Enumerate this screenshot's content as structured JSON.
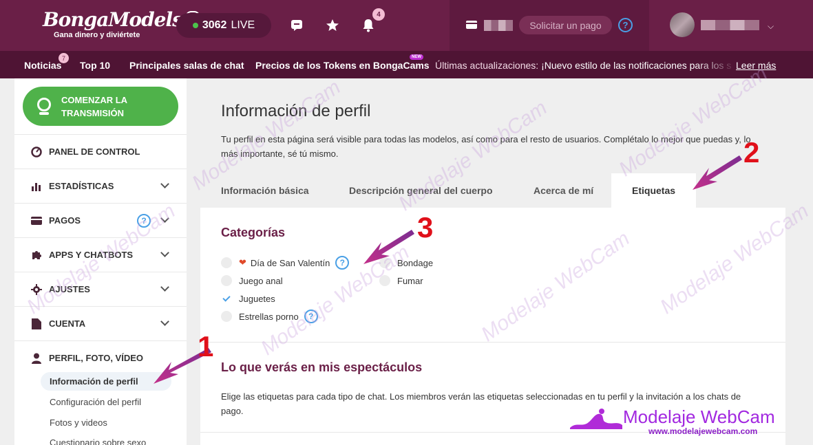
{
  "header": {
    "logo_text": "BongaModels",
    "logo_tagline": "Gana dinero y diviértete",
    "live_count": "3062",
    "live_label": "LIVE",
    "notifications_count": "4",
    "pay_button": "Solicitar un pago",
    "help_glyph": "?"
  },
  "nav": {
    "items": [
      {
        "label": "Noticias",
        "badge": "7"
      },
      {
        "label": "Top 10"
      },
      {
        "label": "Principales salas de chat"
      },
      {
        "label": "Precios de los Tokens en BongaCams",
        "badge": "NEW"
      }
    ],
    "ticker_label": "Últimas actualizaciones:",
    "ticker_text": "¡Nuevo estilo de las notificaciones para los s",
    "ticker_link": "Leer más"
  },
  "sidebar": {
    "start_button": "COMENZAR LA TRANSMISIÓN",
    "items": [
      {
        "label": "PANEL DE CONTROL",
        "icon": "gauge-icon"
      },
      {
        "label": "ESTADÍSTICAS",
        "icon": "bar-chart-icon"
      },
      {
        "label": "PAGOS",
        "icon": "wallet-icon"
      },
      {
        "label": "APPS Y CHATBOTS",
        "icon": "puzzle-icon"
      },
      {
        "label": "AJUSTES",
        "icon": "gear-icon"
      },
      {
        "label": "CUENTA",
        "icon": "document-icon"
      },
      {
        "label": "PERFIL, FOTO, VÍDEO",
        "icon": "user-icon"
      }
    ],
    "sub_items": [
      {
        "label": "Información de perfil",
        "active": true
      },
      {
        "label": "Configuración del perfil"
      },
      {
        "label": "Fotos y videos"
      },
      {
        "label": "Cuestionario sobre sexo"
      }
    ]
  },
  "main": {
    "title": "Información de perfil",
    "description": "Tu perfil en esta página será visible para todas las modelos, así como para el resto de usuarios. Complétalo lo mejor que puedas y, lo más importante, sé tú mismo.",
    "tabs": [
      {
        "label": "Información básica"
      },
      {
        "label": "Descripción general del cuerpo"
      },
      {
        "label": "Acerca de mí"
      },
      {
        "label": "Etiquetas",
        "active": true
      }
    ],
    "categories_title": "Categorías",
    "categories": [
      {
        "label": "Día de San Valentín",
        "checked": false,
        "help": true,
        "heart": true
      },
      {
        "label": "Bondage",
        "checked": false
      },
      {
        "label": "Juego anal",
        "checked": false
      },
      {
        "label": "Fumar",
        "checked": false
      },
      {
        "label": "Juguetes",
        "checked": true
      },
      {
        "label": "Estrellas porno",
        "checked": false,
        "help": true
      }
    ],
    "shows_title": "Lo que verás en mis espectáculos",
    "shows_description": "Elige las etiquetas para cada tipo de chat. Los miembros verán las etiquetas seleccionadas en tu perfil y la invitación a los chats de pago."
  },
  "annotations": [
    "1",
    "2",
    "3"
  ],
  "watermark": {
    "title": "Modelaje WebCam",
    "url": "www.modelajewebcam.com",
    "faint_text": "Modelaje WebCam"
  },
  "colors": {
    "header_bg": "#6a1f47",
    "nav_bg": "#4f1434",
    "start_green": "#4fb24a",
    "section_title": "#6a1f47",
    "help_blue": "#4aa0e6",
    "annotation_red": "#e0101a"
  }
}
